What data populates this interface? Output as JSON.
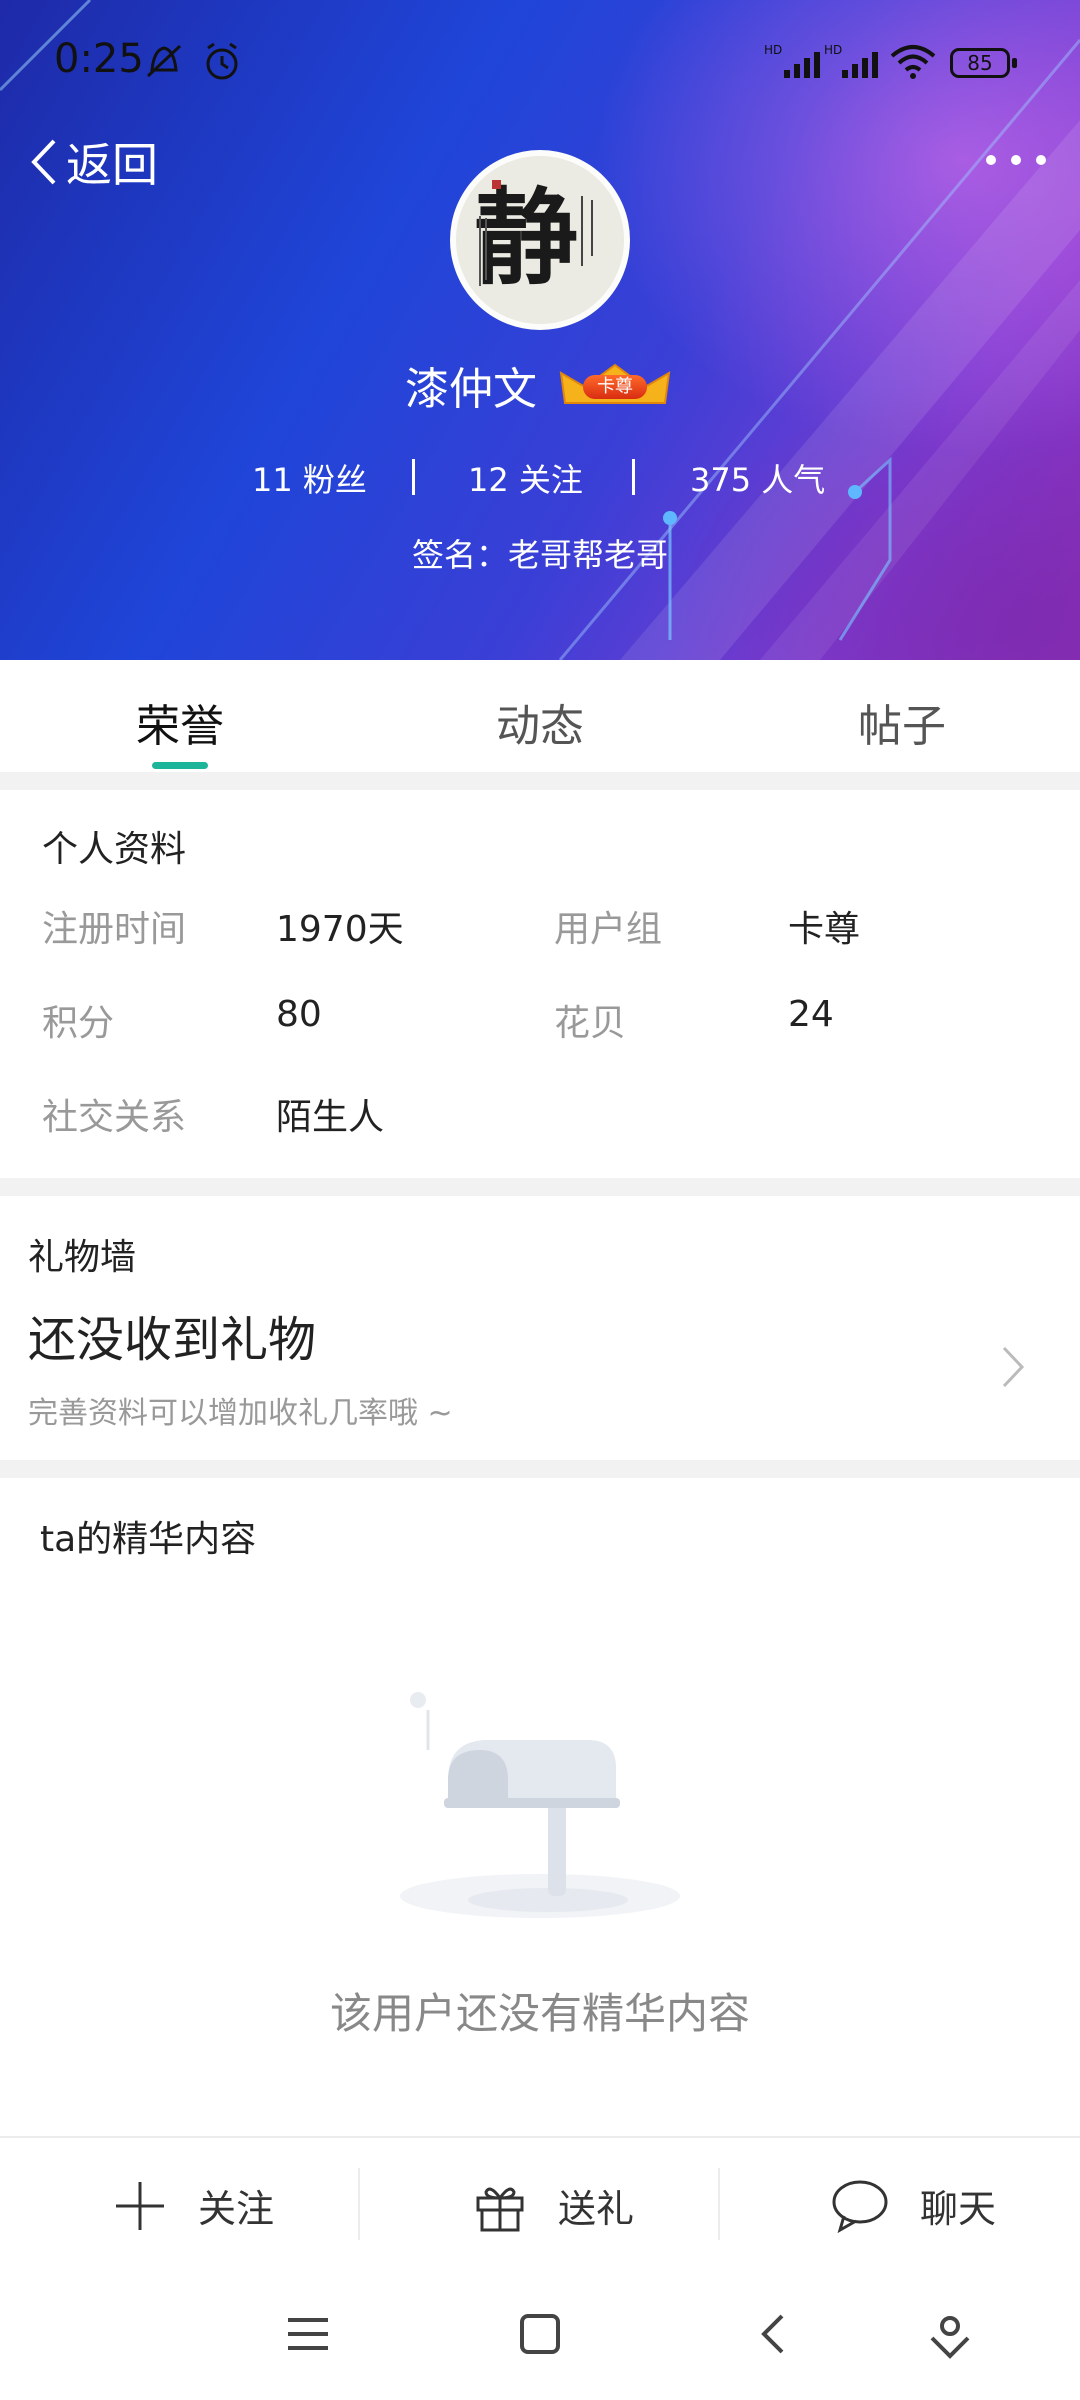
{
  "status": {
    "time": "0:25",
    "battery": "85"
  },
  "header": {
    "back_label": "返回",
    "username": "漆仲文",
    "vip_badge": "卡尊",
    "stats": [
      {
        "value": "11",
        "label": "粉丝"
      },
      {
        "value": "12",
        "label": "关注"
      },
      {
        "value": "375",
        "label": "人气"
      }
    ],
    "signature": "签名：老哥帮老哥",
    "avatar_char": "静"
  },
  "tabs": [
    {
      "label": "荣誉",
      "active": true
    },
    {
      "label": "动态",
      "active": false
    },
    {
      "label": "帖子",
      "active": false
    }
  ],
  "profile": {
    "title": "个人资料",
    "fields": [
      {
        "label": "注册时间",
        "value": "1970天"
      },
      {
        "label": "用户组",
        "value": "卡尊"
      },
      {
        "label": "积分",
        "value": "80"
      },
      {
        "label": "花贝",
        "value": "24"
      },
      {
        "label": "社交关系",
        "value": "陌生人"
      }
    ]
  },
  "gifts": {
    "title": "礼物墙",
    "main": "还没收到礼物",
    "sub": "完善资料可以增加收礼几率哦 ~"
  },
  "featured": {
    "title": "ta的精华内容",
    "empty_text": "该用户还没有精华内容"
  },
  "actions": [
    {
      "label": "关注",
      "icon": "plus-icon"
    },
    {
      "label": "送礼",
      "icon": "gift-icon"
    },
    {
      "label": "聊天",
      "icon": "chat-bubble-icon"
    }
  ],
  "colors": {
    "accent": "#1db59a",
    "header_start": "#1e2aa8",
    "header_end": "#8f2fb8"
  }
}
